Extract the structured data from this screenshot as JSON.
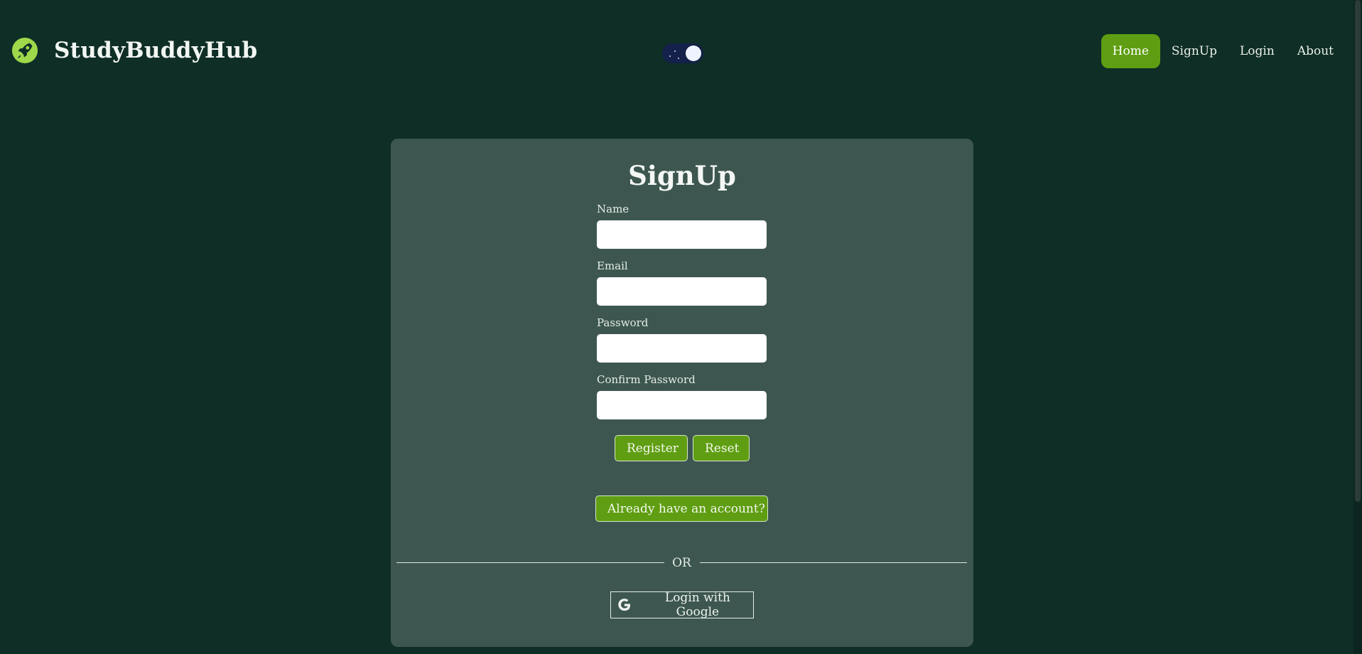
{
  "header": {
    "brand_name": "StudyBuddyHub",
    "logo_icon": "rocket-icon",
    "theme_toggle": {
      "mode": "dark"
    },
    "nav": [
      {
        "label": "Home",
        "active": true
      },
      {
        "label": "SignUp",
        "active": false
      },
      {
        "label": "Login",
        "active": false
      },
      {
        "label": "About",
        "active": false
      }
    ]
  },
  "form": {
    "title": "SignUp",
    "fields": [
      {
        "label": "Name",
        "value": "",
        "placeholder": ""
      },
      {
        "label": "Email",
        "value": "",
        "placeholder": ""
      },
      {
        "label": "Password",
        "value": "",
        "placeholder": ""
      },
      {
        "label": "Confirm Password",
        "value": "",
        "placeholder": ""
      }
    ],
    "register_label": "Register",
    "reset_label": "Reset",
    "already_label": "Already have an account?",
    "or_label": "OR",
    "google_label": "Login with Google",
    "google_icon": "google-icon"
  },
  "colors": {
    "background": "#0f2e26",
    "card": "#3d5750",
    "accent": "#5f9e12",
    "logo": "#9fd84a"
  }
}
